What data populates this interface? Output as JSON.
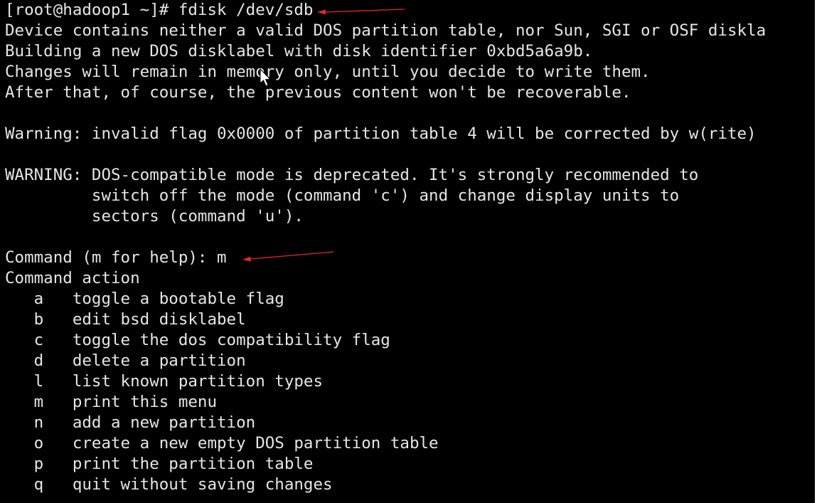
{
  "terminal": {
    "lines": [
      "[root@hadoop1 ~]# fdisk /dev/sdb",
      "Device contains neither a valid DOS partition table, nor Sun, SGI or OSF diskla",
      "Building a new DOS disklabel with disk identifier 0xbd5a6a9b.",
      "Changes will remain in memory only, until you decide to write them.",
      "After that, of course, the previous content won't be recoverable.",
      "",
      "Warning: invalid flag 0x0000 of partition table 4 will be corrected by w(rite)",
      "",
      "WARNING: DOS-compatible mode is deprecated. It's strongly recommended to",
      "         switch off the mode (command 'c') and change display units to",
      "         sectors (command 'u').",
      "",
      "Command (m for help): m",
      "Command action",
      "   a   toggle a bootable flag",
      "   b   edit bsd disklabel",
      "   c   toggle the dos compatibility flag",
      "   d   delete a partition",
      "   l   list known partition types",
      "   m   print this menu",
      "   n   add a new partition",
      "   o   create a new empty DOS partition table",
      "   p   print the partition table",
      "   q   quit without saving changes"
    ]
  },
  "colors": {
    "background": "#000000",
    "text": "#e6e6e6",
    "arrow": "#e8262a",
    "cursor": "#ffffff"
  },
  "overlays": {
    "cursor_icon": "mouse-pointer-icon",
    "arrow_icons": [
      "red-arrow-icon",
      "red-arrow-icon"
    ]
  }
}
